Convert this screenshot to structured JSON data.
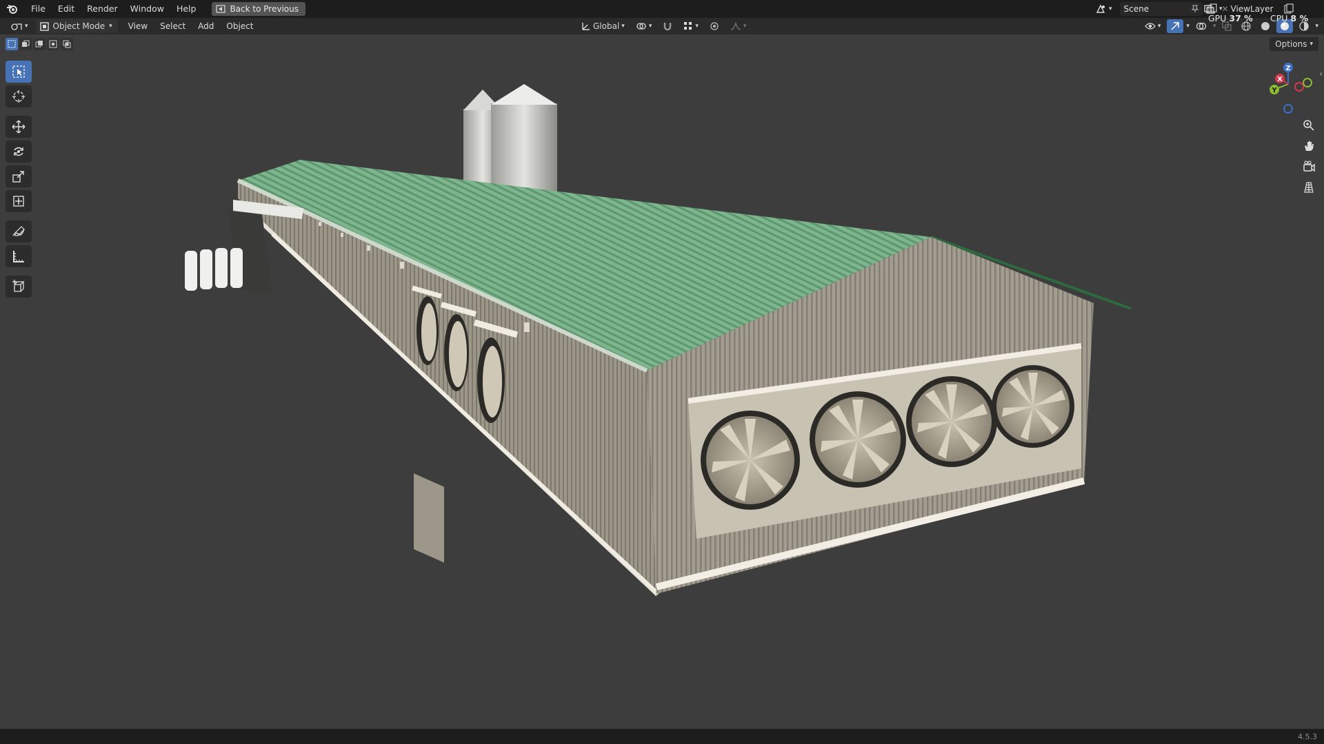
{
  "menu": {
    "items": [
      "File",
      "Edit",
      "Render",
      "Window",
      "Help"
    ],
    "back_button": "Back to Previous"
  },
  "topright": {
    "scene": "Scene",
    "view_layer": "ViewLayer",
    "gpu_label": "GPU",
    "gpu_value": "37 %",
    "cpu_label": "CPU",
    "cpu_value": "8 %"
  },
  "header": {
    "mode": "Object Mode",
    "menus": [
      "View",
      "Select",
      "Add",
      "Object"
    ],
    "orientation": "Global",
    "options": "Options"
  },
  "gizmo": {
    "x": "X",
    "y": "Y",
    "z": "Z"
  },
  "tools": [
    "select-box",
    "cursor",
    "move",
    "rotate",
    "scale",
    "transform",
    "annotate",
    "measure",
    "add-cube"
  ],
  "status": {
    "version": "4.5.3"
  },
  "colors": {
    "accent": "#4772b3",
    "viewport_bg": "#3d3d3d",
    "roof": "#7fb88f",
    "wall": "#a8a294"
  }
}
